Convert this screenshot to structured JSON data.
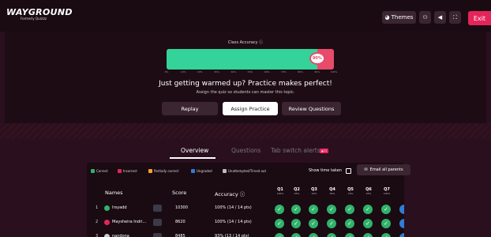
{
  "header": {
    "logo": "WAYGROUND",
    "logo_sub": "Formerly Quizizz",
    "themes_label": "Themes",
    "exit_label": "Exit",
    "icons": [
      "palette-icon",
      "people-icon",
      "volume-icon",
      "fullscreen-icon"
    ]
  },
  "hero": {
    "class_accuracy_label": "Class Accuracy",
    "accuracy_value": 90,
    "accuracy_text": "90%",
    "ticks": [
      "0%",
      "10%",
      "20%",
      "30%",
      "40%",
      "50%",
      "60%",
      "70%",
      "80%",
      "90%",
      "100%"
    ],
    "headline": "Just getting warmed up? Practice makes perfect!",
    "subline": "Assign the quiz so students can master this topic.",
    "buttons": {
      "replay": "Replay",
      "assign": "Assign Practice",
      "review": "Review Questions"
    }
  },
  "tabs": {
    "overview": "Overview",
    "questions": "Questions",
    "tab_switch": "Tab switch alerts",
    "tab_switch_badge": "11"
  },
  "legend": {
    "items": [
      {
        "label": "Correct",
        "color": "#2fb36a"
      },
      {
        "label": "Incorrect",
        "color": "#e5245a"
      },
      {
        "label": "Partially correct",
        "color": "#f5a524"
      },
      {
        "label": "Ungraded",
        "color": "#2f7dd6"
      },
      {
        "label": "Unattempted/Timed out",
        "color": "#bbbbbb"
      }
    ],
    "show_time_taken": "Show time taken",
    "email_all": "Email all parents"
  },
  "table": {
    "headers": {
      "names": "Names",
      "score": "Score",
      "accuracy": "Accuracy"
    },
    "questions": [
      {
        "label": "Q1",
        "pct": "100%"
      },
      {
        "label": "Q2",
        "pct": "95%"
      },
      {
        "label": "Q3",
        "pct": "93%"
      },
      {
        "label": "Q4",
        "pct": "84%"
      },
      {
        "label": "Q5",
        "pct": "79%"
      },
      {
        "label": "Q6",
        "pct": "95%"
      },
      {
        "label": "Q7",
        "pct": "100%"
      }
    ],
    "rows": [
      {
        "rank": "1",
        "name": "Irsyadd",
        "score": "10300",
        "accuracy": "100% (14 / 14 pts)"
      },
      {
        "rank": "2",
        "name": "Maysheira Indri...",
        "score": "8620",
        "accuracy": "100% (14 / 14 pts)"
      },
      {
        "rank": "3",
        "name": "nandona",
        "score": "8485",
        "accuracy": "93% (13 / 14 pts)"
      }
    ]
  }
}
